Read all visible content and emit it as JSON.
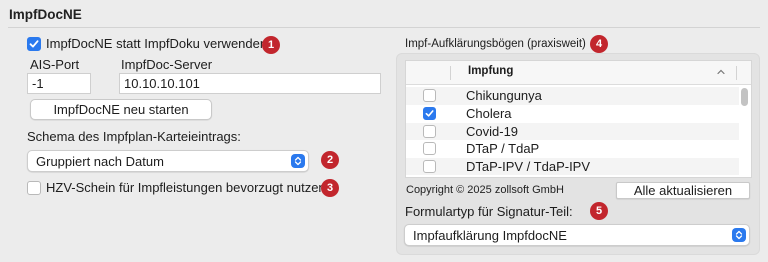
{
  "section": {
    "title": "ImpfDocNE"
  },
  "left": {
    "use_impfdocne": {
      "checked": true,
      "label": "ImpfDocNE statt ImpfDoku verwenden",
      "badge": "1"
    },
    "ais_port": {
      "label": "AIS-Port",
      "value": "-1"
    },
    "impfdoc_server": {
      "label": "ImpfDoc-Server",
      "value": "10.10.10.101"
    },
    "restart_button": "ImpfDocNE neu starten",
    "schema_label": "Schema des Impfplan-Karteieintrags:",
    "schema_popup": {
      "value": "Gruppiert nach Datum",
      "badge": "2"
    },
    "hzv": {
      "checked": false,
      "label": "HZV-Schein für Impfleistungen bevorzugt nutzen",
      "badge": "3"
    }
  },
  "right": {
    "group_title": "Impf-Aufklärungsbögen (praxisweit)",
    "group_badge": "4",
    "table": {
      "column_header": "Impfung",
      "rows": [
        {
          "name": "Chikungunya",
          "checked": false
        },
        {
          "name": "Cholera",
          "checked": true
        },
        {
          "name": "Covid-19",
          "checked": false
        },
        {
          "name": "DTaP / TdaP",
          "checked": false
        },
        {
          "name": "DTaP-IPV / TdaP-IPV",
          "checked": false
        }
      ]
    },
    "copyright": "Copyright © 2025 zollsoft GmbH",
    "update_all_button": "Alle aktualisieren",
    "form_type_label": "Formulartyp für Signatur-Teil:",
    "form_type_badge": "5",
    "form_type_popup": {
      "value": "Impfaufklärung ImpfdocNE"
    }
  },
  "colors": {
    "accent": "#2a79ee",
    "badge": "#c2262d"
  }
}
